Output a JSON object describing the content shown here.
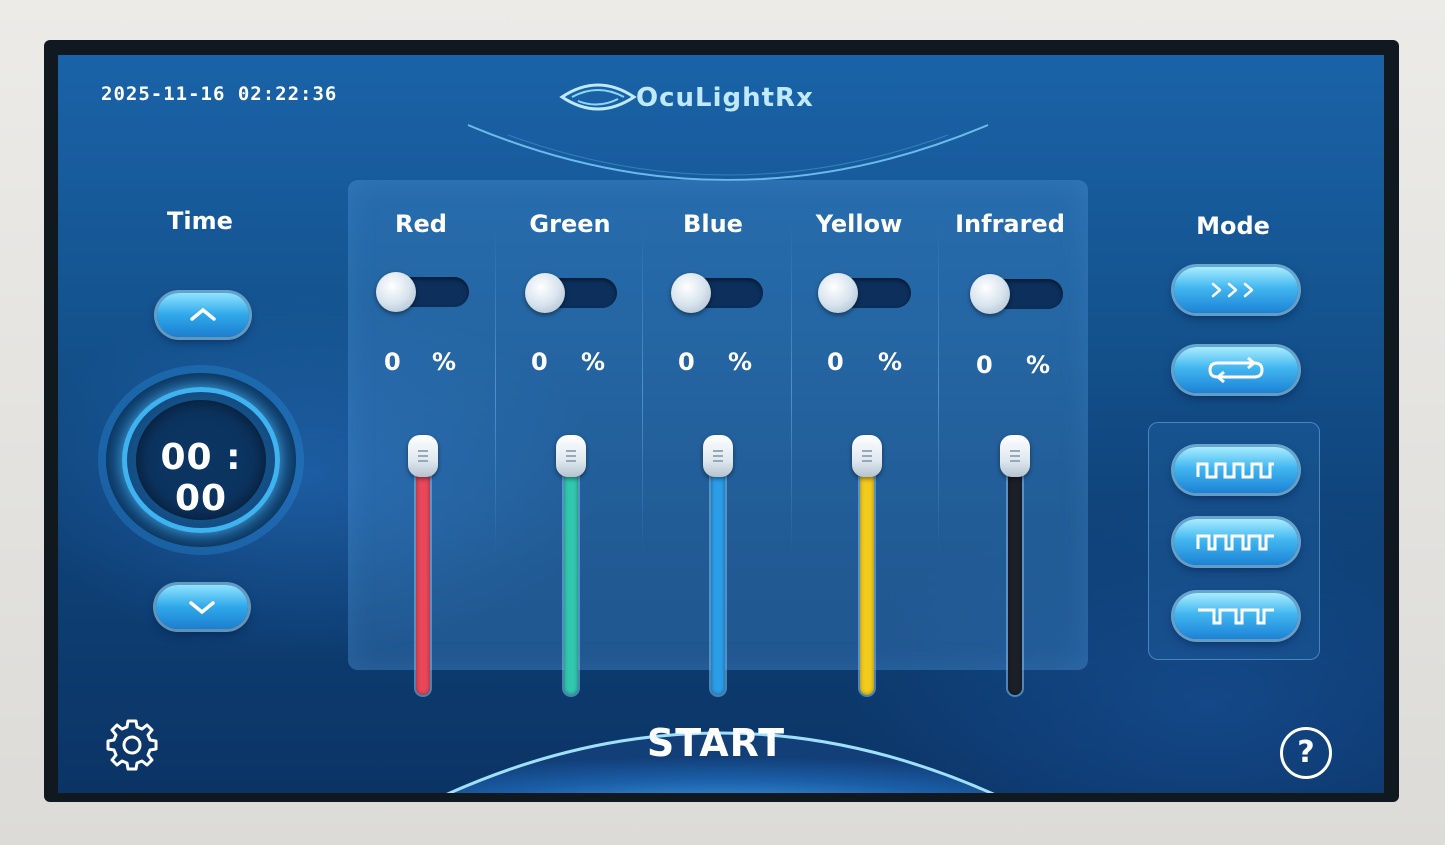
{
  "header": {
    "datetime": "2025-11-16  02:22:36",
    "brand": "OcuLightRx"
  },
  "time": {
    "label": "Time",
    "value": "00 : 00",
    "up_icon": "chevron-up-icon",
    "down_icon": "chevron-down-icon"
  },
  "channels": [
    {
      "name": "Red",
      "percent": "0",
      "percent_sign": "%",
      "enabled": false,
      "color": "#e8485a",
      "level": 0
    },
    {
      "name": "Green",
      "percent": "0",
      "percent_sign": "%",
      "enabled": false,
      "color": "#32c8b0",
      "level": 0
    },
    {
      "name": "Blue",
      "percent": "0",
      "percent_sign": "%",
      "enabled": false,
      "color": "#2b9ee8",
      "level": 0
    },
    {
      "name": "Yellow",
      "percent": "0",
      "percent_sign": "%",
      "enabled": false,
      "color": "#f2cc1c",
      "level": 0
    },
    {
      "name": "Infrared",
      "percent": "0",
      "percent_sign": "%",
      "enabled": false,
      "color": "#1b2028",
      "level": 0
    }
  ],
  "mode": {
    "label": "Mode",
    "buttons": [
      {
        "icon": "sequence-arrows-icon"
      },
      {
        "icon": "loop-icon"
      },
      {
        "icon": "pulse-wave-fast-icon"
      },
      {
        "icon": "pulse-wave-medium-icon"
      },
      {
        "icon": "pulse-wave-slow-icon"
      }
    ]
  },
  "footer": {
    "start_label": "START",
    "settings_icon": "gear-icon",
    "help_label": "?"
  }
}
